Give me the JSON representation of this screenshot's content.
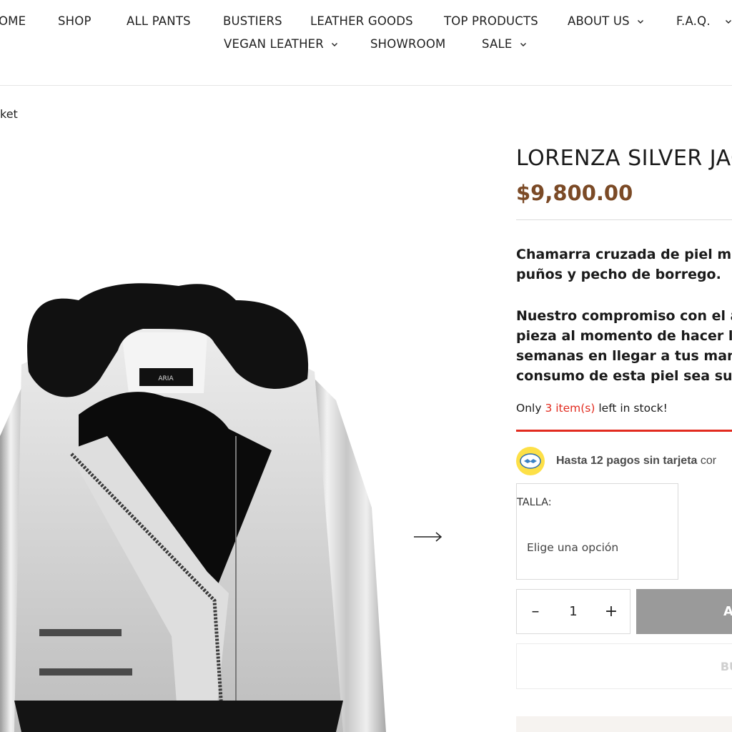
{
  "nav": {
    "row1": [
      {
        "label": "OME",
        "dropdown": false
      },
      {
        "label": "SHOP",
        "dropdown": false
      },
      {
        "label": "ALL PANTS",
        "dropdown": false
      },
      {
        "label": "BUSTIERS",
        "dropdown": false
      },
      {
        "label": "LEATHER GOODS",
        "dropdown": false
      },
      {
        "label": "TOP PRODUCTS",
        "dropdown": false
      },
      {
        "label": "ABOUT US",
        "dropdown": true
      },
      {
        "label": "F.A.Q.",
        "dropdown": true
      }
    ],
    "row2": [
      {
        "label": "VEGAN LEATHER",
        "dropdown": true
      },
      {
        "label": "SHOWROOM",
        "dropdown": false
      },
      {
        "label": "SALE",
        "dropdown": true
      }
    ]
  },
  "breadcrumb": "ket",
  "product": {
    "title": "LORENZA SILVER JAC",
    "price": "$9,800.00",
    "description_1": [
      "Chamarra cruzada de piel meta",
      "puños y pecho de borrego."
    ],
    "description_2": [
      "Nuestro compromiso con el am",
      "pieza al momento de hacer la c",
      "semanas en llegar a tus manos,",
      "consumo de esta piel sea suster"
    ],
    "stock": {
      "prefix": "Only ",
      "highlight": "3 item(s)",
      "suffix": " left in stock!"
    },
    "image_brand_label": "ARIA"
  },
  "payments": {
    "bold": "Hasta 12 pagos sin tarjeta",
    "rest": " cor"
  },
  "size": {
    "label": "TALLA:",
    "placeholder": "Elige una opción"
  },
  "quantity": {
    "minus": "–",
    "value": "1",
    "plus": "+"
  },
  "buttons": {
    "add": "A",
    "buy": "BU"
  },
  "colors": {
    "price": "#7b4a26",
    "stock_accent": "#e22b1f",
    "mercadopago_yellow": "#fde047",
    "add_button": "#9a9a9a"
  },
  "icons": {
    "next": "arrow-right-icon",
    "chevron": "chevron-down-icon",
    "payments": "mercado-pago-handshake-icon"
  }
}
